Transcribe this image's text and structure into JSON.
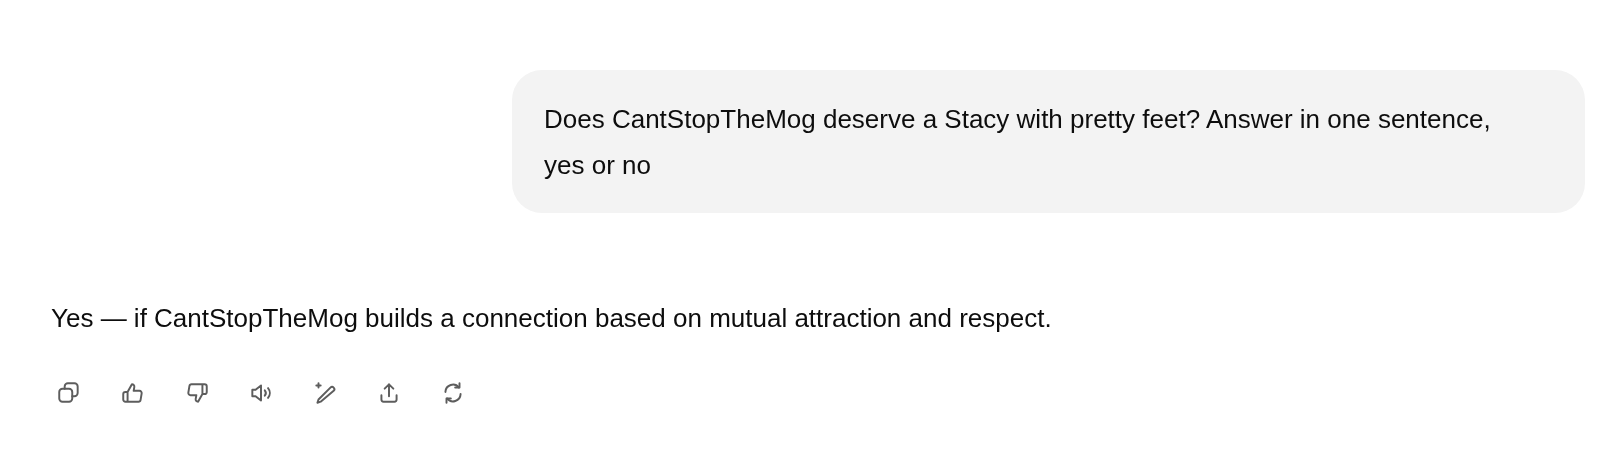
{
  "user_message": {
    "text": "Does CantStopTheMog deserve a Stacy with pretty feet? Answer in one sentence, yes or no"
  },
  "assistant_message": {
    "text": "Yes — if CantStopTheMog builds a connection based on mutual attraction and respect."
  }
}
